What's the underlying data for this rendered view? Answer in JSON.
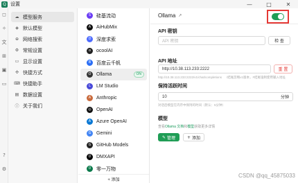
{
  "window": {
    "title": "设置",
    "logo_glyph": "Q",
    "controls": [
      "—",
      "□",
      "✕"
    ]
  },
  "rail": {
    "icons": [
      "chat-icon",
      "sparkle-icon",
      "translate-icon",
      "apps-icon",
      "image-icon",
      "folder-icon",
      "help-icon",
      "settings-icon"
    ],
    "glyphs": [
      "◻",
      "✧",
      "文",
      "⊞",
      "▣",
      "▭",
      "?",
      "⚙"
    ]
  },
  "nav": {
    "items": [
      {
        "label": "模型服务",
        "icon": "☁",
        "active": true
      },
      {
        "label": "默认模型",
        "icon": "◈",
        "active": false
      },
      {
        "label": "网络搜索",
        "icon": "⊕",
        "active": false
      },
      {
        "label": "常规设置",
        "icon": "⚙",
        "active": false
      },
      {
        "label": "显示设置",
        "icon": "▭",
        "active": false
      },
      {
        "label": "快捷方式",
        "icon": "✣",
        "active": false
      },
      {
        "label": "快捷助手",
        "icon": "⌨",
        "active": false
      },
      {
        "label": "数据设置",
        "icon": "▤",
        "active": false
      },
      {
        "label": "关于我们",
        "icon": "ⓘ",
        "active": false
      }
    ]
  },
  "providers": {
    "items": [
      {
        "name": "硅基流动",
        "color": "#6b3df5",
        "glyph": "S",
        "active": false
      },
      {
        "name": "AiHubMix",
        "color": "#111111",
        "glyph": "A",
        "active": false
      },
      {
        "name": "深度求索",
        "color": "#4d6bfe",
        "glyph": "D",
        "active": false
      },
      {
        "name": "ocoolAI",
        "color": "#222222",
        "glyph": "o",
        "active": false
      },
      {
        "name": "百度云千帆",
        "color": "#2a6ef5",
        "glyph": "B",
        "active": false
      },
      {
        "name": "Ollama",
        "color": "#333333",
        "glyph": "O",
        "active": true,
        "badge": "ON"
      },
      {
        "name": "LM Studio",
        "color": "#4a4ad9",
        "glyph": "L",
        "active": false
      },
      {
        "name": "Anthropic",
        "color": "#c96a3c",
        "glyph": "A",
        "active": false
      },
      {
        "name": "OpenAI",
        "color": "#111111",
        "glyph": "◎",
        "active": false
      },
      {
        "name": "Azure OpenAI",
        "color": "#0a78d4",
        "glyph": "A",
        "active": false
      },
      {
        "name": "Gemini",
        "color": "#4285f4",
        "glyph": "G",
        "active": false
      },
      {
        "name": "GitHub Models",
        "color": "#222222",
        "glyph": "G",
        "active": false
      },
      {
        "name": "DMXAPI",
        "color": "#000000",
        "glyph": "D",
        "active": false
      },
      {
        "name": "零一万物",
        "color": "#0b7a4b",
        "glyph": "0",
        "active": false
      }
    ],
    "add_label": "+ 添加"
  },
  "detail": {
    "provider_title": "Ollama",
    "enabled": true,
    "api_key": {
      "label": "API 密钥",
      "placeholder": "API 密钥",
      "check_button": "检 查"
    },
    "api_url": {
      "label": "API 地址",
      "value": "http://10.38.113.233:2222",
      "reset_button": "重 置",
      "hint_left": "http://10.38.113.233:2222/v1/chat/completions",
      "hint_right": "/结尾忽略v1版本，#结尾强制使用输入地址"
    },
    "keep_alive": {
      "label": "保持活跃时间",
      "value": "10",
      "unit": "分钟",
      "hint": "对话后模型在内存中保持的时间（默认：5分钟）"
    },
    "models": {
      "label": "模型",
      "hint_prefix": "查看",
      "hint_link1": "Ollama 文档",
      "hint_mid": "和",
      "hint_link2": "模型",
      "hint_suffix": "获取更多详情",
      "manage_button": "管理",
      "add_button": "添加"
    },
    "watermark": "CSDN @qq_45875033"
  }
}
